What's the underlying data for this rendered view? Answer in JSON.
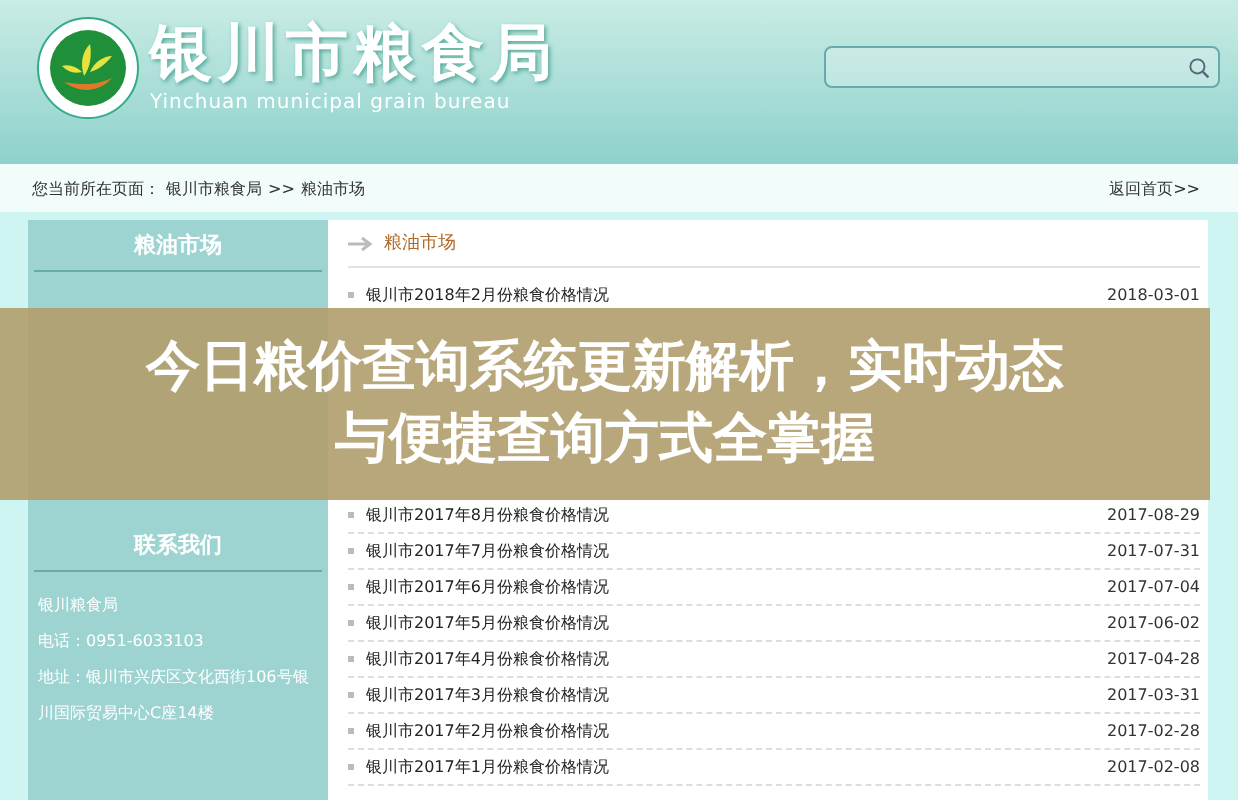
{
  "header": {
    "title": "银川市粮食局",
    "subtitle": "Yinchuan municipal grain bureau"
  },
  "breadcrumb": {
    "prefix": "您当前所在页面：",
    "items": [
      "银川市粮食局",
      "粮油市场"
    ],
    "separator": ">>",
    "home_link": "返回首页>>"
  },
  "sidebar": {
    "heading": "粮油市场",
    "contact": {
      "heading": "联系我们",
      "name": "银川粮食局",
      "phone": "电话：0951-6033103",
      "address": "地址：银川市兴庆区文化西街106号银川国际贸易中心C座14楼"
    }
  },
  "main": {
    "heading": "粮油市场",
    "rows_above_banner": [
      {
        "title": "银川市2018年2月份粮食价格情况",
        "date": "2018-03-01"
      }
    ],
    "rows_below_banner": [
      {
        "title": "银川市2017年8月份粮食价格情况",
        "date": "2017-08-29"
      },
      {
        "title": "银川市2017年7月份粮食价格情况",
        "date": "2017-07-31"
      },
      {
        "title": "银川市2017年6月份粮食价格情况",
        "date": "2017-07-04"
      },
      {
        "title": "银川市2017年5月份粮食价格情况",
        "date": "2017-06-02"
      },
      {
        "title": "银川市2017年4月份粮食价格情况",
        "date": "2017-04-28"
      },
      {
        "title": "银川市2017年3月份粮食价格情况",
        "date": "2017-03-31"
      },
      {
        "title": "银川市2017年2月份粮食价格情况",
        "date": "2017-02-28"
      },
      {
        "title": "银川市2017年1月份粮食价格情况",
        "date": "2017-02-08"
      }
    ]
  },
  "banner": {
    "lines": [
      "今日粮价查询系统更新解析，实时动态",
      "与便捷查询方式全掌握"
    ]
  }
}
